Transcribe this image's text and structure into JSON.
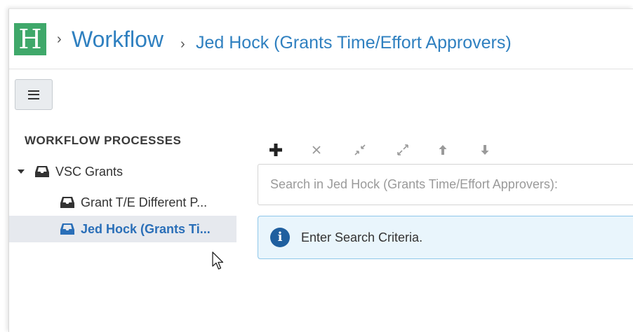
{
  "header": {
    "logo_letter": "H",
    "separator": "›",
    "breadcrumb_root": "Workflow",
    "breadcrumb_current": "Jed Hock (Grants Time/Effort Approvers)"
  },
  "sidebar": {
    "title": "WORKFLOW PROCESSES",
    "tree": [
      {
        "label": "VSC Grants",
        "expanded": true,
        "icon": "inbox-icon"
      },
      {
        "label": "Grant T/E Different P...",
        "icon": "inbox-icon"
      },
      {
        "label": "Jed Hock (Grants Ti...",
        "icon": "inbox-icon",
        "selected": true
      }
    ]
  },
  "toolbar": {
    "icons": [
      "plus-icon",
      "close-icon",
      "collapse-icon",
      "expand-icon",
      "arrow-up-icon",
      "arrow-down-icon"
    ]
  },
  "search": {
    "placeholder": "Search in Jed Hock (Grants Time/Effort Approvers):",
    "value": ""
  },
  "info": {
    "icon": "info-icon",
    "message": "Enter Search Criteria."
  },
  "colors": {
    "logo_bg": "#3fa86a",
    "link": "#2f80c0",
    "selected_row_bg": "#e6e9ee",
    "info_bg": "#e9f5fc",
    "info_border": "#8fc7ea",
    "info_icon": "#1f5f9f"
  }
}
